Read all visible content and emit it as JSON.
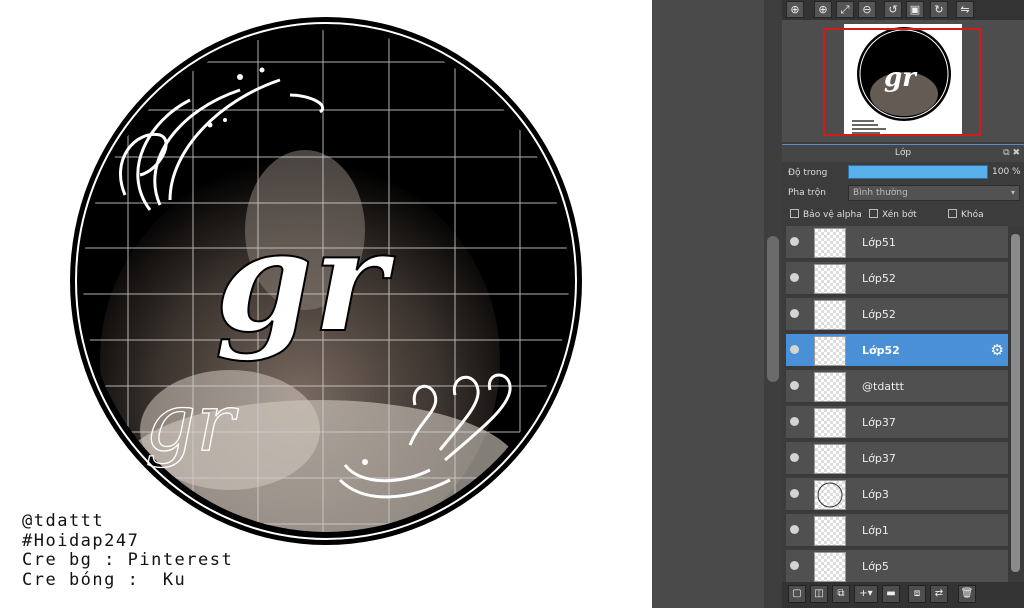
{
  "credits": {
    "line1": "@tdattt",
    "line2": "#Hoidap247",
    "line3": "Cre bg : Pinterest",
    "line4": "Cre bóng :  Ku"
  },
  "artwork": {
    "title_text": "gr",
    "small_text": "gr"
  },
  "navigator": {
    "toolbar_icons": [
      "zoom-in-icon",
      "zoom-out-icon",
      "fit-icon",
      "zoom-out-small-icon",
      "rotate-left-icon",
      "fullscreen-icon",
      "rotate-right-icon",
      "flip-icon"
    ],
    "frame_color": "#d21a1a"
  },
  "layer_panel": {
    "title": "Lớp",
    "opacity_label": "Độ trong",
    "opacity_value": "100 %",
    "opacity_percent": 100,
    "blend_label": "Pha trộn",
    "blend_value": "Bình thường",
    "protect_alpha_label": "Bảo vệ alpha",
    "clipping_label": "Xén bớt",
    "lock_label": "Khóa",
    "accent_color": "#4a90d6",
    "layers": [
      {
        "name": "Lớp51",
        "selected": false
      },
      {
        "name": "Lớp52",
        "selected": false
      },
      {
        "name": "Lớp52",
        "selected": false
      },
      {
        "name": "Lớp52",
        "selected": true
      },
      {
        "name": "@tdattt",
        "selected": false
      },
      {
        "name": "Lớp37",
        "selected": false
      },
      {
        "name": "Lớp37",
        "selected": false
      },
      {
        "name": "Lớp3",
        "selected": false
      },
      {
        "name": "Lớp1",
        "selected": false
      },
      {
        "name": "Lớp5",
        "selected": false
      }
    ]
  },
  "bottom_toolbar": {
    "icons": [
      "new-layer-icon",
      "new-folder-layer-icon",
      "duplicate-layer-icon",
      "add-layer-menu-icon",
      "folder-icon",
      "merge-layer-icon",
      "transfer-layer-icon",
      "delete-layer-icon"
    ]
  }
}
